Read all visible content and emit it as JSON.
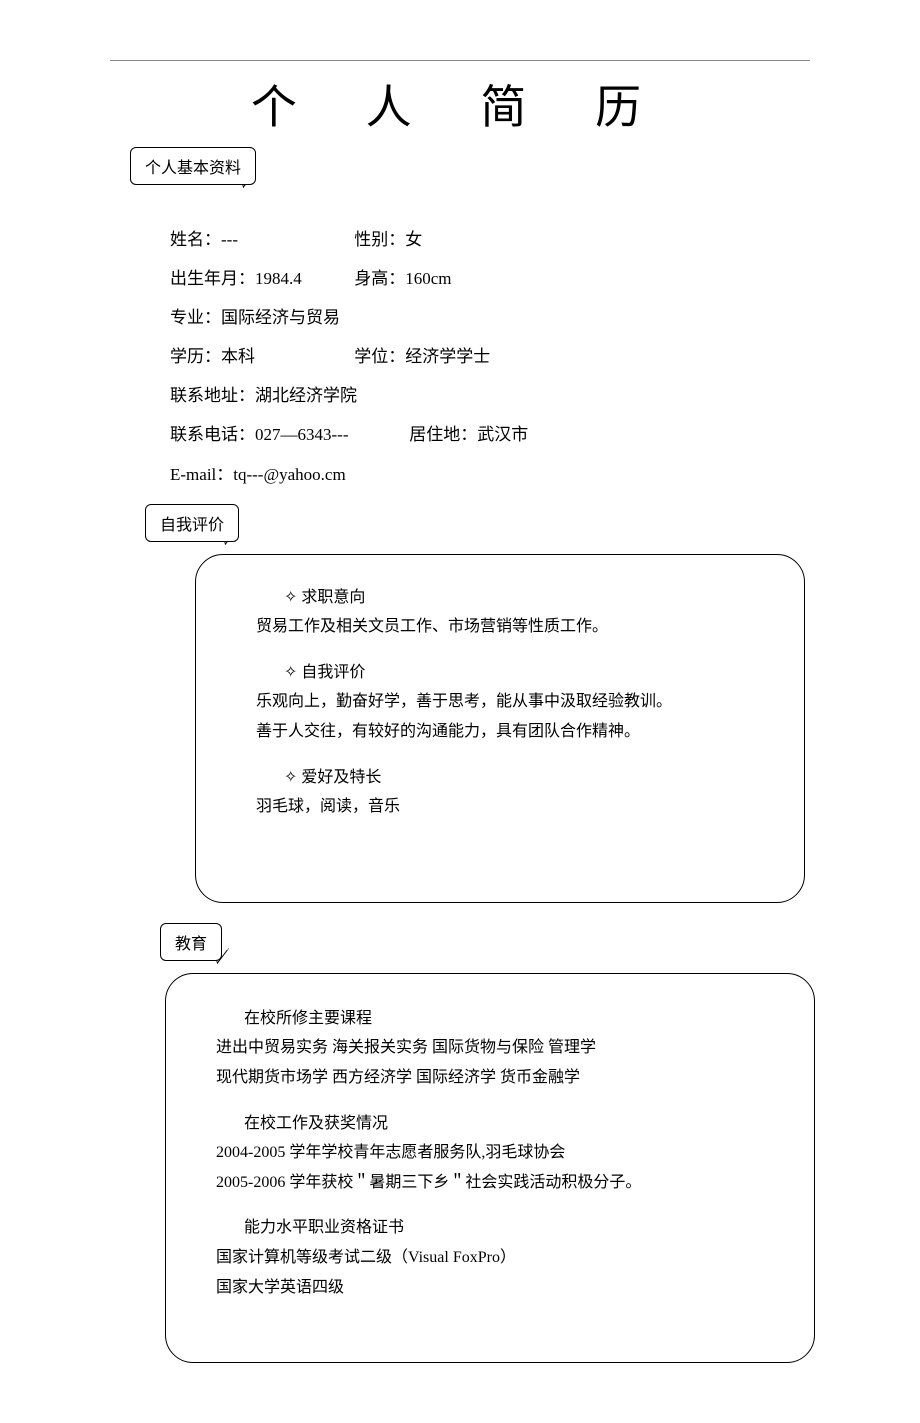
{
  "title": "个 人 简 历",
  "labels": {
    "basic": "个人基本资料",
    "self_eval": "自我评价",
    "education": "教育"
  },
  "basic": {
    "name_label": "姓名：",
    "name_value": "---",
    "gender_label": "性别：",
    "gender_value": "女",
    "birth_label": "出生年月：",
    "birth_value": "1984.4",
    "height_label": "身高：",
    "height_value": "160cm",
    "major_label": "专业：",
    "major_value": "国际经济与贸易",
    "edu_label": "学历：",
    "edu_value": "本科",
    "degree_label": "学位：",
    "degree_value": "经济学学士",
    "addr_label": "联系地址：",
    "addr_value": "湖北经济学院",
    "phone_label": "联系电话：",
    "phone_value": "027—6343---",
    "location_label": "居住地：",
    "location_value": "武汉市",
    "email_label": "E-mail：",
    "email_value": "tq---@yahoo.cm"
  },
  "self_eval": {
    "intent_h": "求职意向",
    "intent_body": "贸易工作及相关文员工作、市场营销等性质工作。",
    "eval_h": "自我评价",
    "eval_l1": "乐观向上，勤奋好学，善于思考，能从事中汲取经验教训。",
    "eval_l2": "善于人交往，有较好的沟通能力，具有团队合作精神。",
    "hobby_h": "爱好及特长",
    "hobby_body": "羽毛球，阅读，音乐"
  },
  "education": {
    "courses_h": "在校所修主要课程",
    "courses_l1": "进出中贸易实务  海关报关实务  国际货物与保险  管理学",
    "courses_l2": "现代期货市场学    西方经济学  国际经济学  货币金融学",
    "work_h": "在校工作及获奖情况",
    "work_l1": "2004-2005 学年学校青年志愿者服务队,羽毛球协会",
    "work_l2": "2005-2006 学年获校＂暑期三下乡＂社会实践活动积极分子。",
    "cert_h": "能力水平职业资格证书",
    "cert_l1": "国家计算机等级考试二级（Visual FoxPro）",
    "cert_l2": "国家大学英语四级"
  },
  "diamond": "✧"
}
